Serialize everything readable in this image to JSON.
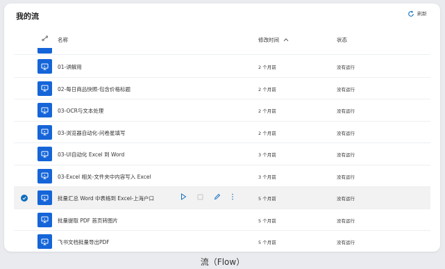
{
  "page": {
    "title": "我的流",
    "refresh_label": "刷新"
  },
  "table": {
    "headers": {
      "name": "名称",
      "modified": "修改时间",
      "status": "状态"
    },
    "rows": [
      {
        "name": "01-讲解用",
        "modified": "2 个月前",
        "status": "没有运行",
        "selected": false
      },
      {
        "name": "02-每日商品快照-包含价格标题",
        "modified": "2 个月前",
        "status": "没有运行",
        "selected": false
      },
      {
        "name": "03-OCR与文本处理",
        "modified": "2 个月前",
        "status": "没有运行",
        "selected": false
      },
      {
        "name": "03-浏览器自动化-问卷星填写",
        "modified": "2 个月前",
        "status": "没有运行",
        "selected": false
      },
      {
        "name": "03-UI自动化 Excel 到 Word",
        "modified": "3 个月前",
        "status": "没有运行",
        "selected": false
      },
      {
        "name": "03-Excel 相关-文件夹中内容写入 Excel",
        "modified": "3 个月前",
        "status": "没有运行",
        "selected": false
      },
      {
        "name": "批量汇总 Word 中表格到 Excel-上海户口",
        "modified": "5 个月前",
        "status": "没有运行",
        "selected": true
      },
      {
        "name": "批量提取 PDF 首页转图片",
        "modified": "5 个月前",
        "status": "没有运行",
        "selected": false
      },
      {
        "name": "飞书文档批量导出PDF",
        "modified": "5 个月前",
        "status": "没有运行",
        "selected": false
      }
    ]
  },
  "caption": "流（Flow）",
  "colors": {
    "accent": "#1565d8",
    "selected_row": "#f2f2f2",
    "background": "#e9ebee"
  },
  "icons": {
    "refresh": "refresh-icon",
    "flow_type_header": "flow-type-icon",
    "sort": "sort-ascending-icon",
    "flow_tile": "desktop-flow-icon",
    "run": "play-icon",
    "stop": "stop-icon",
    "edit": "pencil-icon",
    "more": "more-vertical-icon",
    "check": "checkmark-icon"
  }
}
